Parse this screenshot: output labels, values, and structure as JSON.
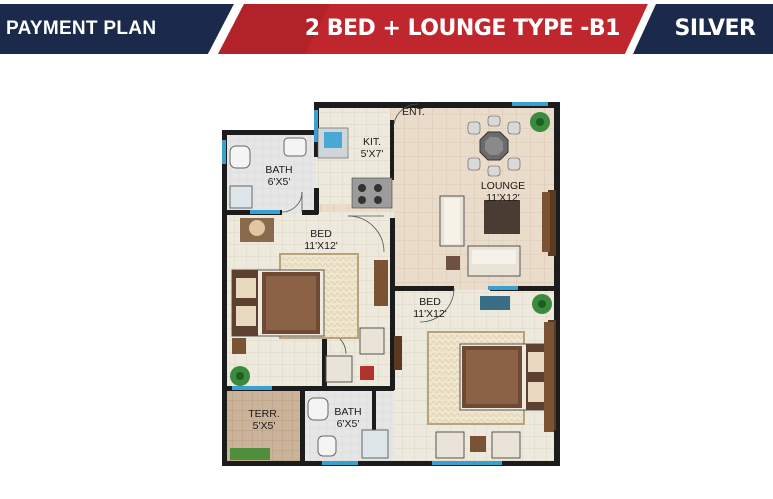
{
  "banner": {
    "left_title": "PAYMENT PLAN",
    "unit_type": "2 BED + LOUNGE TYPE -B1",
    "category": "SILVER",
    "colors": {
      "navy": "#1b2a4a",
      "red": "#c0262d",
      "white": "#ffffff"
    }
  },
  "floor_plan": {
    "entrance": "ENT.",
    "kitchen": {
      "name": "KIT.",
      "size": "5'X7'"
    },
    "lounge": {
      "name": "LOUNGE",
      "size": "11'X12'"
    },
    "bath_top": {
      "name": "BATH",
      "size": "6'X5'"
    },
    "bed_left": {
      "name": "BED",
      "size": "11'X12'"
    },
    "bed_right": {
      "name": "BED",
      "size": "11'X12'"
    },
    "terrace": {
      "name": "TERR.",
      "size": "5'X5'"
    },
    "bath_bottom": {
      "name": "BATH",
      "size": "6'X5'"
    }
  }
}
